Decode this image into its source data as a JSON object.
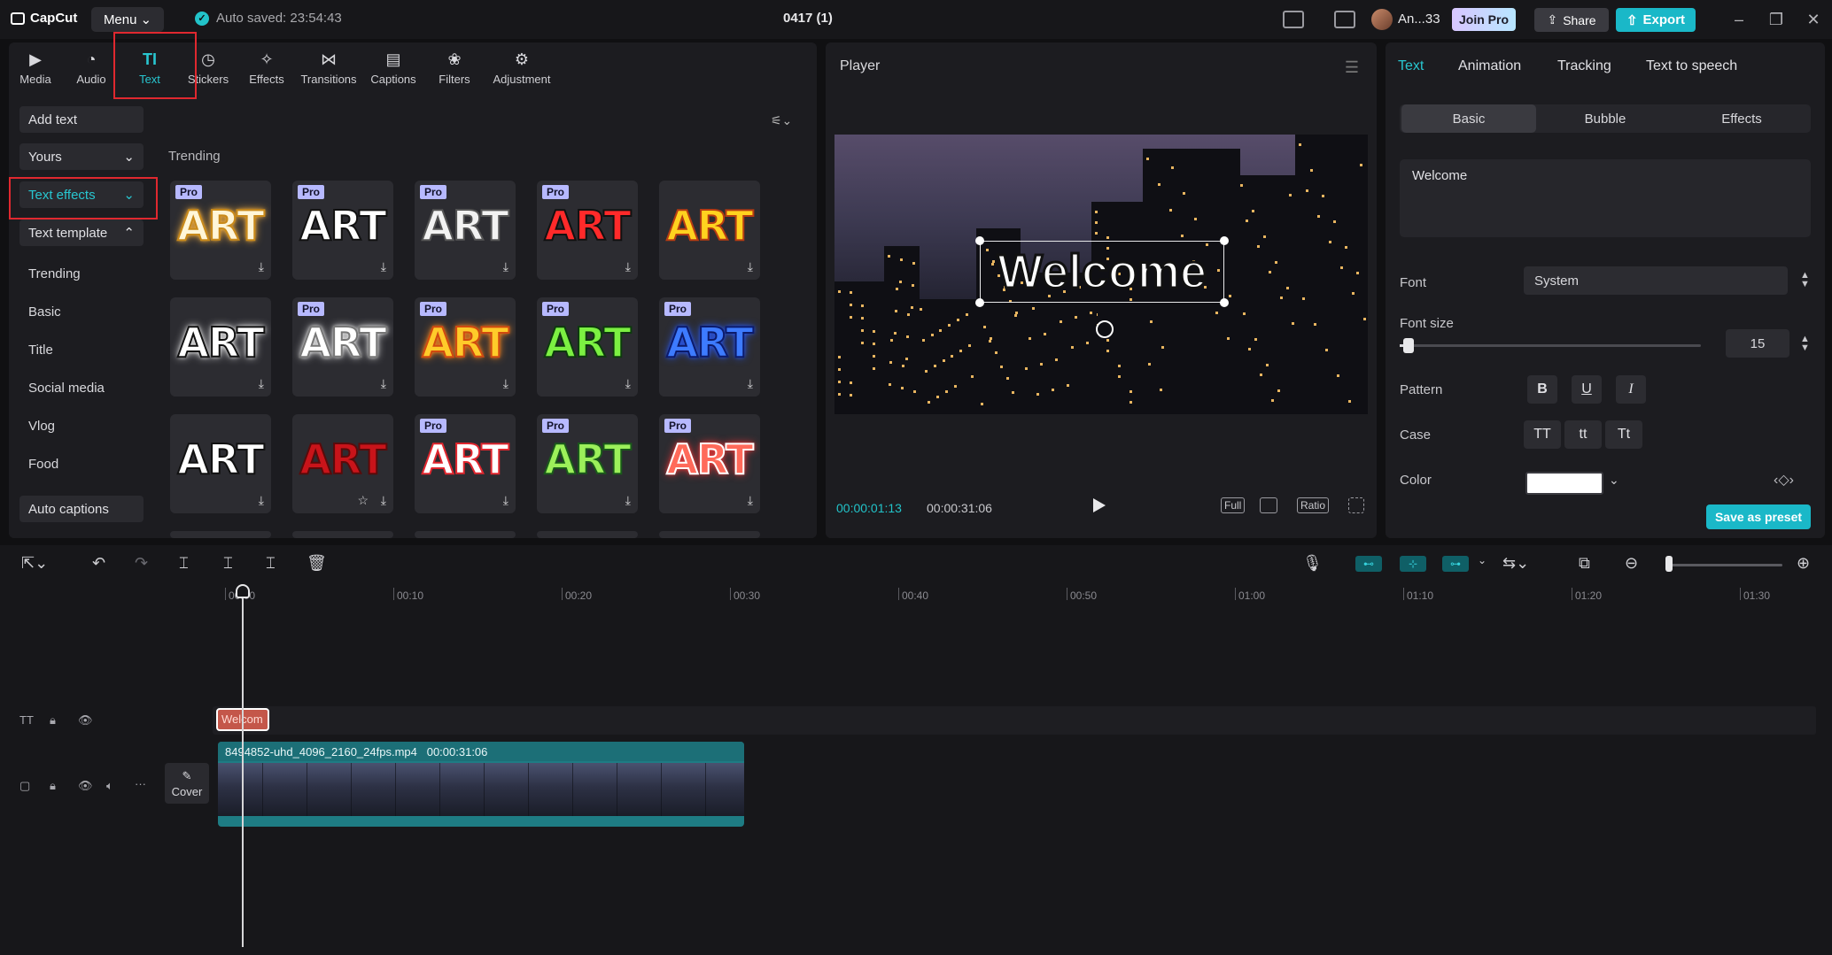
{
  "app": {
    "name": "CapCut",
    "menu_label": "Menu",
    "autosave": "Auto saved: 23:54:43",
    "project_title": "0417 (1)",
    "username": "An...33",
    "join_pro": "Join Pro",
    "share": "Share",
    "export": "Export"
  },
  "toolbar": [
    {
      "label": "Media",
      "icon": "media-icon"
    },
    {
      "label": "Audio",
      "icon": "audio-icon"
    },
    {
      "label": "Text",
      "icon": "text-icon",
      "active": true
    },
    {
      "label": "Stickers",
      "icon": "stickers-icon"
    },
    {
      "label": "Effects",
      "icon": "effects-icon"
    },
    {
      "label": "Transitions",
      "icon": "transitions-icon"
    },
    {
      "label": "Captions",
      "icon": "captions-icon"
    },
    {
      "label": "Filters",
      "icon": "filters-icon"
    },
    {
      "label": "Adjustment",
      "icon": "adjustment-icon"
    }
  ],
  "sidebar": {
    "add_text": "Add text",
    "yours": "Yours",
    "text_effects": "Text effects",
    "text_template": "Text template",
    "items": [
      "Trending",
      "Basic",
      "Title",
      "Social media",
      "Vlog",
      "Food"
    ],
    "auto_captions": "Auto captions"
  },
  "gallery": {
    "section": "Trending",
    "card_text": "ART",
    "pro_label": "Pro",
    "cards": [
      {
        "pro": true,
        "fill": "#fff6d8",
        "stroke": "#c98a1a",
        "glow": "#ffb640"
      },
      {
        "pro": true,
        "fill": "#ffffff",
        "stroke": "#111111",
        "glow": ""
      },
      {
        "pro": true,
        "fill": "#f2f2f2",
        "stroke": "#555555",
        "glow": ""
      },
      {
        "pro": true,
        "fill": "#ff2a2a",
        "stroke": "#111111",
        "glow": ""
      },
      {
        "pro": false,
        "fill": "#ffd21f",
        "stroke": "#b63c12",
        "glow": ""
      },
      {
        "pro": false,
        "fill": "#ffffff",
        "stroke": "#111111",
        "glow": "#ffffff"
      },
      {
        "pro": true,
        "fill": "#ffffff",
        "stroke": "#777777",
        "glow": "#ffffff"
      },
      {
        "pro": true,
        "fill": "#ffcb2a",
        "stroke": "#d04a10",
        "glow": "#ff8a20"
      },
      {
        "pro": true,
        "fill": "#7cf042",
        "stroke": "#0d3a0d",
        "glow": ""
      },
      {
        "pro": true,
        "fill": "#3d7bff",
        "stroke": "#0c1b6b",
        "glow": "#2a5cff"
      },
      {
        "pro": false,
        "fill": "#ffffff",
        "stroke": "#111111",
        "glow": ""
      },
      {
        "pro": false,
        "fill": "#c8141a",
        "stroke": "#5a0a0a",
        "glow": "",
        "star": true
      },
      {
        "pro": true,
        "fill": "#ffffff",
        "stroke": "#e0262e",
        "glow": ""
      },
      {
        "pro": true,
        "fill": "#9cf05a",
        "stroke": "#1a5a1a",
        "glow": ""
      },
      {
        "pro": true,
        "fill": "#ff6a5a",
        "stroke": "#ffffff",
        "glow": "#ff3a3a"
      }
    ]
  },
  "player": {
    "title": "Player",
    "overlay_text": "Welcome",
    "current_time": "00:00:01:13",
    "duration": "00:00:31:06",
    "btn_full": "Full",
    "btn_ratio": "Ratio"
  },
  "inspector": {
    "tabs": [
      "Text",
      "Animation",
      "Tracking",
      "Text to speech"
    ],
    "subtabs": [
      "Basic",
      "Bubble",
      "Effects"
    ],
    "text_value": "Welcome",
    "font_label": "Font",
    "font_value": "System",
    "font_size_label": "Font size",
    "font_size_value": "15",
    "font_size_fraction": 0.03,
    "pattern_label": "Pattern",
    "pattern_buttons": [
      "B",
      "U",
      "I"
    ],
    "case_label": "Case",
    "case_buttons": [
      "TT",
      "tt",
      "Tt"
    ],
    "color_label": "Color",
    "color_value": "#ffffff",
    "save_preset": "Save as preset"
  },
  "timeline": {
    "ruler": [
      "00:00",
      "00:10",
      "00:20",
      "00:30",
      "00:40",
      "00:50",
      "01:00",
      "01:10",
      "01:20",
      "01:30"
    ],
    "text_clip": "Welcom",
    "video_clip_name": "8494852-uhd_4096_2160_24fps.mp4",
    "video_clip_duration": "00:00:31:06",
    "cover_label": "Cover"
  }
}
